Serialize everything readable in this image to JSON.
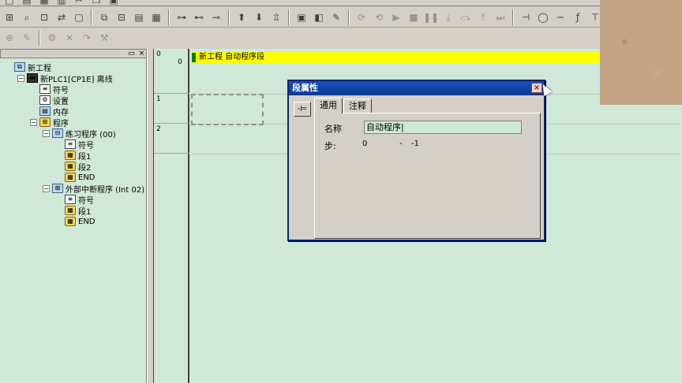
{
  "toolbar": {
    "row1_icons": [
      "new-icon",
      "open-icon",
      "save-icon",
      "print-icon",
      "cut-icon",
      "copy-icon",
      "paste-icon"
    ],
    "row2_groups": [
      [
        "project-icon",
        "search-icon",
        "find-icon",
        "replace-icon",
        "window-icon"
      ],
      [
        "network-icon",
        "io-icon",
        "memory-icon",
        "table-icon"
      ],
      [
        "rung10-icon",
        "rung16-icon",
        "rung16b-icon"
      ],
      [
        "online-icon",
        "download-icon",
        "upload-icon"
      ],
      [
        "monitor-icon",
        "watch-icon",
        "edit-icon"
      ],
      [
        "run-icon",
        "sim-icon",
        "play-icon",
        "stop-icon",
        "pause-icon",
        "step-into-icon",
        "step-over-icon",
        "step-out-icon",
        "forward-icon"
      ],
      [
        "contact-icon",
        "coil-icon",
        "line-icon",
        "fn-icon",
        "ht-icon"
      ]
    ],
    "row3_icons": [
      "zoom-icon",
      "edit-icon",
      "compile-icon",
      "cross-icon",
      "jump-icon",
      "tools-icon"
    ]
  },
  "tree": {
    "nodes": [
      {
        "label": "新工程",
        "icon": "network-icon",
        "indent": 0,
        "expander": ""
      },
      {
        "label": "新PLC1[CP1E] 离线",
        "icon": "plc-icon",
        "indent": 1,
        "expander": "−"
      },
      {
        "label": "符号",
        "icon": "symbol-icon",
        "indent": 2,
        "expander": ""
      },
      {
        "label": "设置",
        "icon": "settings-icon",
        "indent": 2,
        "expander": ""
      },
      {
        "label": "内存",
        "icon": "memory-icon",
        "indent": 2,
        "expander": ""
      },
      {
        "label": "程序",
        "icon": "program-icon",
        "indent": 2,
        "expander": "−"
      },
      {
        "label": "练习程序 (00)",
        "icon": "task-icon",
        "indent": 3,
        "expander": "−"
      },
      {
        "label": "符号",
        "icon": "symbol-icon",
        "indent": 4,
        "expander": ""
      },
      {
        "label": "段1",
        "icon": "section-icon",
        "indent": 4,
        "expander": ""
      },
      {
        "label": "段2",
        "icon": "section-icon",
        "indent": 4,
        "expander": ""
      },
      {
        "label": "END",
        "icon": "section-icon",
        "indent": 4,
        "expander": ""
      },
      {
        "label": "外部中断程序 (Int 02)",
        "icon": "interrupt-icon",
        "indent": 3,
        "expander": "−"
      },
      {
        "label": "符号",
        "icon": "symbol-icon",
        "indent": 4,
        "expander": ""
      },
      {
        "label": "段1",
        "icon": "section-icon",
        "indent": 4,
        "expander": ""
      },
      {
        "label": "END",
        "icon": "section-icon",
        "indent": 4,
        "expander": ""
      }
    ]
  },
  "ladder": {
    "rungs": [
      {
        "num1": "0",
        "num2": "0"
      },
      {
        "num1": "1",
        "num2": ""
      },
      {
        "num1": "2",
        "num2": ""
      }
    ],
    "segment_bar": "新工程  自动程序段"
  },
  "dialog": {
    "title": "段属性",
    "pin_label": "-⊨",
    "tabs": [
      "通用",
      "注释"
    ],
    "name_label": "名称",
    "name_value": "自动程序|",
    "step_label": "步:",
    "step_start": "0",
    "step_dash": "-",
    "step_end": "-1"
  },
  "colors": {
    "workspace_bg": "#d0e8d8",
    "segment_bar": "#ffff00",
    "dialog_title": "#0a3a9a"
  }
}
